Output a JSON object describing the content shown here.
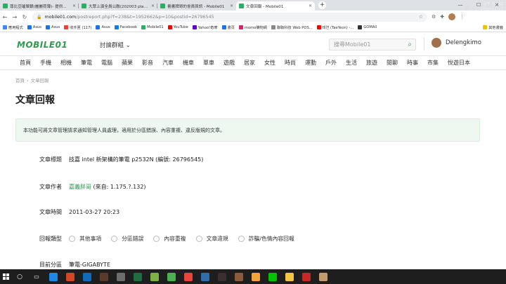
{
  "browser": {
    "tabs": [
      {
        "title": "尊比亞璀璨銀(麗麗荷薄)- 提供...",
        "active": false,
        "color": "#2cae66"
      },
      {
        "title": "大眾上演全員公敵(202003 play...",
        "active": false,
        "color": "#2cae66"
      },
      {
        "title": "書書牌哥的會員資訊 - Mobile01",
        "active": false,
        "color": "#2cae66"
      },
      {
        "title": "文章回報 - Mobile01",
        "active": true,
        "color": "#2cae66"
      }
    ],
    "close_glyph": "×",
    "new_tab_glyph": "+",
    "window_controls": [
      "—",
      "☐",
      "✕"
    ],
    "url_host": "mobile01.com",
    "url_path": "/postreport.php?f=238&t=1952662&p=10&postid=26796545",
    "bookmarks": [
      {
        "label": "應用程式",
        "color": "#4285f4"
      },
      {
        "label": "Asus",
        "color": "#1a73e8"
      },
      {
        "label": "Asus",
        "color": "#1a73e8"
      },
      {
        "label": "收件匣 (117)",
        "color": "#ea4335"
      },
      {
        "label": "Asus",
        "color": "#1a73e8"
      },
      {
        "label": "Facebook",
        "color": "#1877f2"
      },
      {
        "label": "Mobile01",
        "color": "#2cae66"
      },
      {
        "label": "YouTube",
        "color": "#ff0000"
      },
      {
        "label": "Yahoo!奇摩",
        "color": "#6001d2"
      },
      {
        "label": "書頁",
        "color": "#1a73e8"
      },
      {
        "label": "momo購物網",
        "color": "#d6246e"
      },
      {
        "label": "聯聯科技 Web POS...",
        "color": "#888888"
      },
      {
        "label": "태연 (TaeYeon) -...",
        "color": "#ff0000"
      },
      {
        "label": "GOMAll",
        "color": "#333333"
      }
    ],
    "other_bookmarks": "其他書籤"
  },
  "site": {
    "logo": "MOBILE01",
    "forum_menu": "討論群組",
    "search_placeholder": "搜尋Mobile01",
    "username": "Delengkimo",
    "categories": [
      "首頁",
      "手機",
      "相機",
      "筆電",
      "電腦",
      "蘋果",
      "影音",
      "汽車",
      "機車",
      "單車",
      "遊戲",
      "居家",
      "女性",
      "時尚",
      "運動",
      "戶外",
      "生活",
      "旅遊",
      "閒聊",
      "時事",
      "市集",
      "悅遊日本"
    ]
  },
  "page": {
    "breadcrumb": [
      "首頁",
      "文章回報"
    ],
    "breadcrumb_sep": "›",
    "title": "文章回報",
    "notice": "本功能可將文章管理請求通知管理人員處理，適用於分區錯誤、內容重複、違反版規的文章。",
    "fields": {
      "post_title_label": "文章標題",
      "post_title_value": "技嘉 intel 新架構的筆電 p2532N (編號: 26796545)",
      "author_label": "文章作者",
      "author_name": "嘉義胖哥",
      "author_from": "(來自: 1.175.?.132)",
      "time_label": "文章時間",
      "time_value": "2011-03-27 20:23",
      "type_label": "回報類型",
      "type_options": [
        "其他事項",
        "分區錯誤",
        "內容重複",
        "文章違規",
        "詐騙/色情內容回報"
      ],
      "section_label": "目前分區",
      "section_value": "筆電-GIGABYTE"
    }
  },
  "taskbar": {
    "apps": [
      {
        "name": "edge",
        "color": "#1e88e5"
      },
      {
        "name": "powerpoint",
        "color": "#d24726"
      },
      {
        "name": "outlook",
        "color": "#0f6cbd"
      },
      {
        "name": "game",
        "color": "#5a3a2a"
      },
      {
        "name": "app-grey",
        "color": "#6d6d6d"
      },
      {
        "name": "excel",
        "color": "#1d6f42"
      },
      {
        "name": "app-green",
        "color": "#7cb342"
      },
      {
        "name": "app-green2",
        "color": "#4caf50"
      },
      {
        "name": "chrome",
        "color": "#e8453c"
      },
      {
        "name": "app-blue",
        "color": "#2f6ea8"
      },
      {
        "name": "app-dark",
        "color": "#3b2f2f"
      },
      {
        "name": "app-brown",
        "color": "#8d5b3a"
      },
      {
        "name": "app-orange",
        "color": "#f2a33a"
      },
      {
        "name": "line",
        "color": "#00c300"
      },
      {
        "name": "app-yellow",
        "color": "#f4c542"
      },
      {
        "name": "app-red",
        "color": "#c62828"
      },
      {
        "name": "app-tan",
        "color": "#c49a6c"
      }
    ],
    "tray_icons": [
      "^",
      "▣",
      "◐",
      "♪",
      "英"
    ],
    "clock_time": "上午 10:42",
    "clock_date": "2020/12/12"
  }
}
